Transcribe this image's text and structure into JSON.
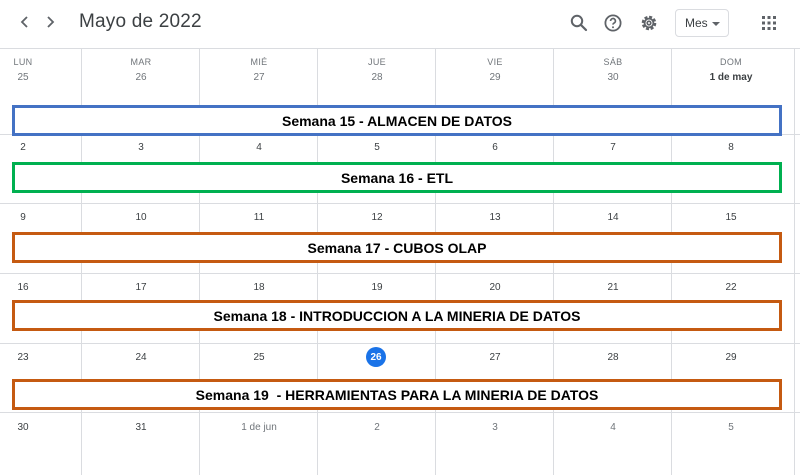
{
  "header": {
    "prev_label": "‹",
    "next_label": "›",
    "title": "Mayo de 2022",
    "view_select": "Mes",
    "icons": [
      "chevron-left-icon",
      "chevron-right-icon",
      "search-icon",
      "help-icon",
      "gear-icon",
      "apps-grid-icon"
    ]
  },
  "weekdays": [
    "LUN",
    "MAR",
    "MIÉ",
    "JUE",
    "VIE",
    "SÁB",
    "DOM"
  ],
  "weeks": [
    {
      "days": [
        "25",
        "26",
        "27",
        "28",
        "29",
        "30",
        "1 de may"
      ]
    },
    {
      "days": [
        "2",
        "3",
        "4",
        "5",
        "6",
        "7",
        "8"
      ]
    },
    {
      "days": [
        "9",
        "10",
        "11",
        "12",
        "13",
        "14",
        "15"
      ]
    },
    {
      "days": [
        "16",
        "17",
        "18",
        "19",
        "20",
        "21",
        "22"
      ]
    },
    {
      "days": [
        "23",
        "24",
        "25",
        "26",
        "27",
        "28",
        "29"
      ]
    },
    {
      "days": [
        "30",
        "31",
        "1 de jun",
        "2",
        "3",
        "4",
        "5"
      ]
    }
  ],
  "today": "26",
  "banners": [
    {
      "label": "Semana 15 - ALMACEN DE DATOS",
      "color": "#4472c4"
    },
    {
      "label": "Semana 16 - ETL",
      "color": "#00b050"
    },
    {
      "label": "Semana 17 - CUBOS OLAP",
      "color": "#c55a11"
    },
    {
      "label": "Semana 18 - INTRODUCCION A LA MINERIA DE DATOS",
      "color": "#c55a11"
    },
    {
      "label": "Semana 19  - HERRAMIENTAS PARA LA MINERIA DE DATOS",
      "color": "#c55a11"
    }
  ],
  "colors": {
    "today_bg": "#1a73e8",
    "grid_line": "#dadce0",
    "muted_text": "#70757a"
  }
}
